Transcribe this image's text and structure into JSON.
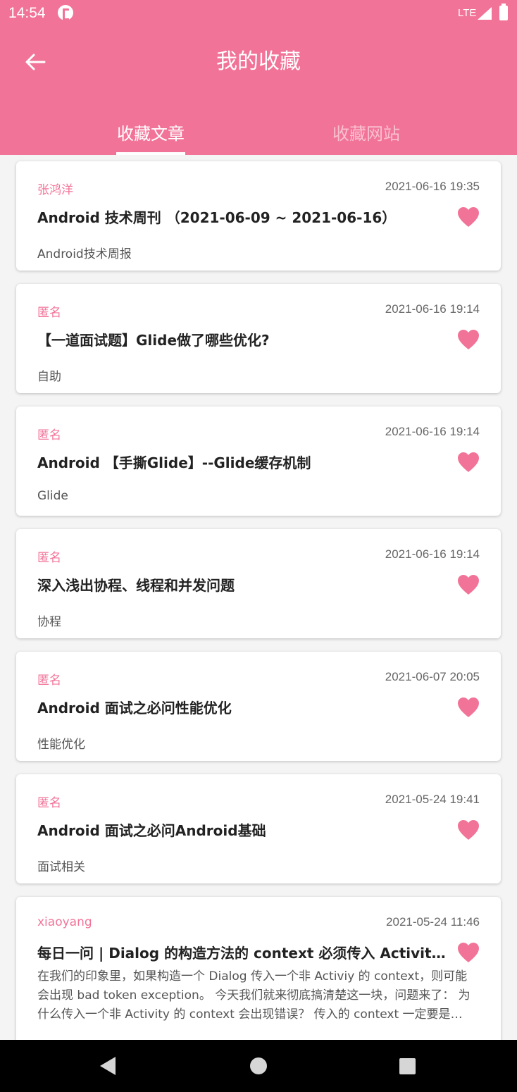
{
  "colors": {
    "accent": "#f27398",
    "heart": "#f27398"
  },
  "status_bar": {
    "time": "14:54",
    "network": "LTE"
  },
  "header": {
    "title": "我的收藏",
    "back_icon": "arrow-left-icon"
  },
  "tabs": [
    {
      "label": "收藏文章",
      "selected": true
    },
    {
      "label": "收藏网站",
      "selected": false
    }
  ],
  "articles": [
    {
      "author": "张鸿洋",
      "date": "2021-06-16 19:35",
      "title": "Android 技术周刊 （2021-06-09 ~ 2021-06-16）",
      "desc": "Android技术周报",
      "favorite": true
    },
    {
      "author": "匿名",
      "date": "2021-06-16 19:14",
      "title": "【一道面试题】Glide做了哪些优化?",
      "desc": "自助",
      "favorite": true
    },
    {
      "author": "匿名",
      "date": "2021-06-16 19:14",
      "title": "Android 【手撕Glide】--Glide缓存机制",
      "desc": "Glide",
      "favorite": true
    },
    {
      "author": "匿名",
      "date": "2021-06-16 19:14",
      "title": "深入浅出协程、线程和并发问题",
      "desc": "协程",
      "favorite": true
    },
    {
      "author": "匿名",
      "date": "2021-06-07 20:05",
      "title": "Android 面试之必问性能优化",
      "desc": "性能优化",
      "favorite": true
    },
    {
      "author": "匿名",
      "date": "2021-05-24 19:41",
      "title": "Android 面试之必问Android基础",
      "desc": "面试相关",
      "favorite": true
    },
    {
      "author": "xiaoyang",
      "date": "2021-05-24 11:46",
      "title": "每日一问 | Dialog 的构造方法的 context 必须传入 Activity吗？",
      "desc": "在我们的印象里，如果构造一个 Dialog 传入一个非 Activiy 的 context，则可能会出现 bad token exception。 今天我们就来彻底搞清楚这一块，问题来了： 为什么传入一个非 Activity 的 context 会出现错误？ 传入的 context 一定要是 Activity 吗？",
      "favorite": true
    }
  ],
  "nav_bar": {
    "back": "nav-back-icon",
    "home": "nav-home-icon",
    "recents": "nav-recents-icon"
  }
}
